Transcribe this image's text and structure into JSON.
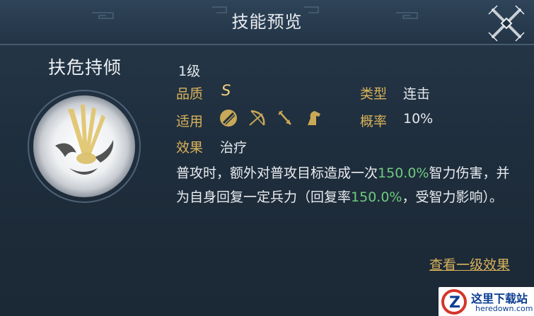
{
  "dialog": {
    "title": "技能预览"
  },
  "skill": {
    "name": "扶危持倾",
    "level": "1级",
    "quality_label": "品质",
    "quality_value": "S",
    "type_label": "类型",
    "type_value": "连击",
    "applicable_label": "适用",
    "applicable_troops": [
      "spear-icon",
      "bow-icon",
      "arrow-icon",
      "horse-icon"
    ],
    "rate_label": "概率",
    "rate_value": "10%",
    "effect_label": "效果",
    "effect_value": "治疗",
    "desc": {
      "p1": "普攻时，额外对普攻目标造成一次",
      "v1": "150.0%",
      "p2": "智力伤害，并为自身回复一定兵力（回复率",
      "v2": "150.0%",
      "p3": "，受智力影响）。"
    }
  },
  "footer": {
    "view_level1_label": "查看一级效果"
  },
  "watermark": {
    "cn": "这里下载站",
    "en": "heredown.com"
  },
  "colors": {
    "gold_label": "#d9b25a",
    "highlight_green": "#6ecb7e",
    "background": "#1f2e3d"
  }
}
